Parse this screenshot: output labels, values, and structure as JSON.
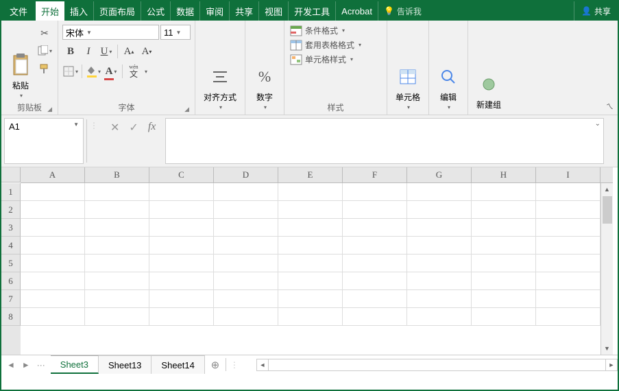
{
  "tabs": {
    "file": "文件",
    "home": "开始",
    "insert": "插入",
    "layout": "页面布局",
    "formula": "公式",
    "data": "数据",
    "review": "审阅",
    "share": "共享",
    "view": "视图",
    "dev": "开发工具",
    "acrobat": "Acrobat",
    "tellme": "告诉我",
    "sharebtn": "共享"
  },
  "ribbon": {
    "clipboard": {
      "label": "剪贴板",
      "paste": "粘贴"
    },
    "font": {
      "label": "字体",
      "name": "宋体",
      "size": "11",
      "wen": "wén",
      "wenchar": "文"
    },
    "align": {
      "label": "对齐方式"
    },
    "number": {
      "label": "数字",
      "pct": "%"
    },
    "styles": {
      "label": "样式",
      "cond": "条件格式",
      "table": "套用表格格式",
      "cell": "单元格样式"
    },
    "cells": {
      "label": "单元格"
    },
    "edit": {
      "label": "编辑"
    },
    "group": {
      "label": "新建组"
    }
  },
  "fbar": {
    "name": "A1",
    "fx": "fx"
  },
  "grid": {
    "cols": [
      "A",
      "B",
      "C",
      "D",
      "E",
      "F",
      "G",
      "H",
      "I"
    ],
    "rows": [
      "1",
      "2",
      "3",
      "4",
      "5",
      "6",
      "7",
      "8"
    ]
  },
  "sheets": {
    "dots": "···",
    "s1": "Sheet3",
    "s2": "Sheet13",
    "s3": "Sheet14"
  }
}
